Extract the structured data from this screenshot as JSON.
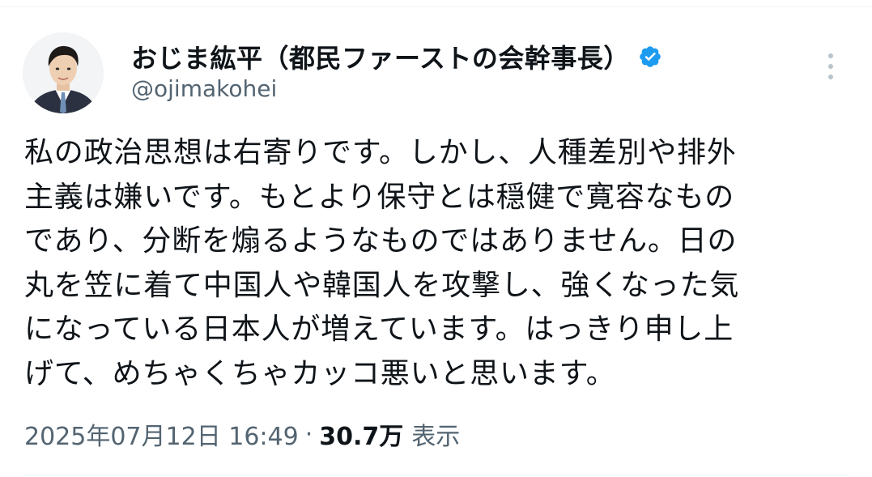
{
  "author": {
    "display_name": "おじま紘平（都民ファーストの会幹事長）",
    "handle": "@ojimakohei",
    "verified_color": "#1d9bf0"
  },
  "tweet": {
    "lines": [
      "私の政治思想は右寄りです。しかし、人種差別や排外",
      "主義は嫌いです。もとより保守とは穏健で寛容なもの",
      "であり、分断を煽るようなものではありません。日の",
      "丸を笠に着て中国人や韓国人を攻撃し、強くなった気",
      "になっている日本人が増えています。はっきり申し上",
      "げて、めちゃくちゃカッコ悪いと思います。"
    ]
  },
  "meta": {
    "timestamp": "2025年07月12日 16:49",
    "separator": "·",
    "views_count": "30.7万",
    "views_label": "表示"
  },
  "icons": {
    "avatar": "profile-photo",
    "verified": "verified-badge-icon",
    "more": "more-options-icon"
  }
}
